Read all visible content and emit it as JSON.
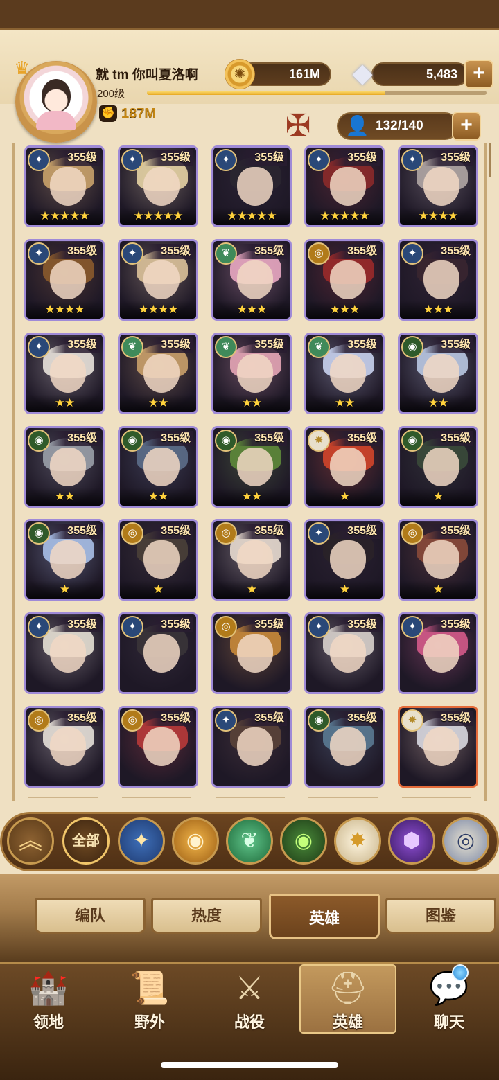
{
  "player": {
    "name": "就 tm 你叫夏洛啊",
    "level": "200级",
    "exp_fraction": 0.7,
    "power": "187M"
  },
  "resources": {
    "gold": "161M",
    "gems": "5,483",
    "hero_count": "132/140"
  },
  "icons": {
    "coin": "coin-icon",
    "gem": "diamond-icon",
    "plus": "+",
    "person": "person-icon",
    "fist": "fist-icon",
    "emblem": "guild-emblem-icon"
  },
  "heroes": [
    {
      "level": "355级",
      "stars": "★★★★★",
      "faction": "lightbearer-alt",
      "color": "#c9a26a"
    },
    {
      "level": "355级",
      "stars": "★★★★★",
      "faction": "lightbearer",
      "color": "#e6d3a4"
    },
    {
      "level": "355级",
      "stars": "★★★★★",
      "faction": "dimensional",
      "color": "#2a2630"
    },
    {
      "level": "355级",
      "stars": "★★★★★",
      "faction": "dimensional",
      "color": "#8b2a2a"
    },
    {
      "level": "355级",
      "stars": "★★★★",
      "faction": "lightbearer-alt",
      "color": "#b0a6a4"
    },
    {
      "level": "355级",
      "stars": "★★★★",
      "faction": "lightbearer-alt",
      "color": "#8a5a2c"
    },
    {
      "level": "355级",
      "stars": "★★★★",
      "faction": "lightbearer",
      "color": "#dcc29a"
    },
    {
      "level": "355级",
      "stars": "★★★",
      "faction": "wilder",
      "color": "#e9a8c2"
    },
    {
      "level": "355级",
      "stars": "★★★",
      "faction": "mauler",
      "color": "#9a2a2a"
    },
    {
      "level": "355级",
      "stars": "★★★",
      "faction": "lightbearer",
      "color": "#3a2630"
    },
    {
      "level": "355级",
      "stars": "★★",
      "faction": "lightbearer",
      "color": "#e8e2da"
    },
    {
      "level": "355级",
      "stars": "★★",
      "faction": "wilder",
      "color": "#c9a06a"
    },
    {
      "level": "355级",
      "stars": "★★",
      "faction": "wilder",
      "color": "#e6a6b6"
    },
    {
      "level": "355级",
      "stars": "★★",
      "faction": "wilder-alt",
      "color": "#c8d2ee"
    },
    {
      "level": "355级",
      "stars": "★★",
      "faction": "graveborn",
      "color": "#b9c8e2"
    },
    {
      "level": "355级",
      "stars": "★★",
      "faction": "graveborn",
      "color": "#9aa0a8"
    },
    {
      "level": "355级",
      "stars": "★★",
      "faction": "graveborn",
      "color": "#5c6e8a"
    },
    {
      "level": "355级",
      "stars": "★★",
      "faction": "graveborn",
      "color": "#5e8a3a"
    },
    {
      "level": "355级",
      "stars": "★",
      "faction": "celestial",
      "color": "#d2452a"
    },
    {
      "level": "355级",
      "stars": "★",
      "faction": "graveborn",
      "color": "#3a4a3a"
    },
    {
      "level": "355级",
      "stars": "★",
      "faction": "graveborn",
      "color": "#a8c0e8"
    },
    {
      "level": "355级",
      "stars": "★",
      "faction": "mauler",
      "color": "#4a4038"
    },
    {
      "level": "355级",
      "stars": "★",
      "faction": "mauler",
      "color": "#e8dcd0"
    },
    {
      "level": "355级",
      "stars": "★",
      "faction": "lightbearer",
      "color": "#2a2228"
    },
    {
      "level": "355级",
      "stars": "★",
      "faction": "mauler",
      "color": "#8a4a3a"
    },
    {
      "level": "355级",
      "stars": "",
      "faction": "lightbearer",
      "color": "#e6e0d4"
    },
    {
      "level": "355级",
      "stars": "",
      "faction": "lightbearer",
      "color": "#3a3438"
    },
    {
      "level": "355级",
      "stars": "",
      "faction": "mauler",
      "color": "#c98a3a"
    },
    {
      "level": "355级",
      "stars": "",
      "faction": "lightbearer-alt",
      "color": "#d8d2cc"
    },
    {
      "level": "355级",
      "stars": "",
      "faction": "lightbearer",
      "color": "#d45a8a"
    },
    {
      "level": "355级",
      "stars": "",
      "faction": "mauler",
      "color": "#e6e0d8"
    },
    {
      "level": "355级",
      "stars": "",
      "faction": "mauler",
      "color": "#b83a3a"
    },
    {
      "level": "355级",
      "stars": "",
      "faction": "dimensional",
      "color": "#5a4238"
    },
    {
      "level": "355级",
      "stars": "",
      "faction": "graveborn",
      "color": "#5a7a92"
    },
    {
      "level": "355级",
      "stars": "",
      "faction": "celestial",
      "color": "#d8d8e0"
    }
  ],
  "filters": {
    "up": "︽",
    "all": "全部",
    "light": "✦",
    "mauler": "◉",
    "wilder": "❦",
    "graveborn": "◉",
    "celestial": "✸",
    "hypogean": "⬢",
    "dimensional": "◎"
  },
  "subtabs": {
    "formation": "编队",
    "popularity": "热度",
    "heroes": "英雄",
    "codex": "图鉴"
  },
  "nav": {
    "territory": "领地",
    "outside": "野外",
    "campaign": "战役",
    "heroes": "英雄",
    "chat": "聊天"
  }
}
